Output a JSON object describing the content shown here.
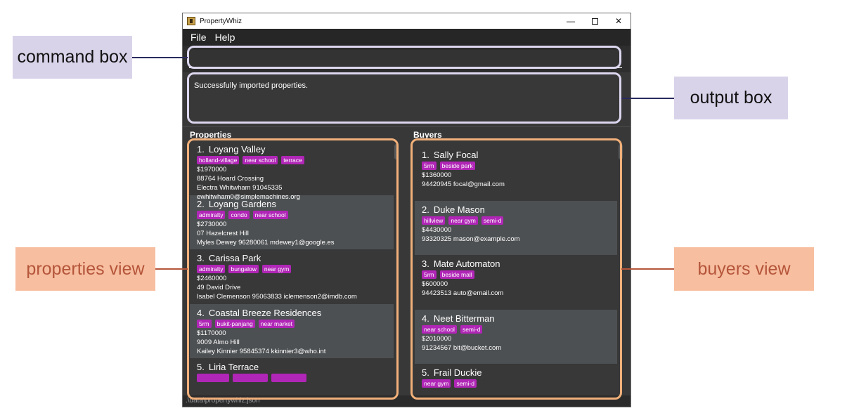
{
  "window": {
    "title": "PropertyWhiz",
    "controls": {
      "minimize": "—",
      "close": "✕"
    }
  },
  "menu": {
    "file": "File",
    "help": "Help"
  },
  "command": {
    "value": ""
  },
  "output": {
    "text": "Successfully imported properties."
  },
  "properties": {
    "title": "Properties",
    "items": [
      {
        "index": "1.",
        "name": "Loyang Valley",
        "tags": [
          "holland-village",
          "near school",
          "terrace"
        ],
        "price": "$1970000",
        "address": "88764 Hoard Crossing",
        "seller": "Electra Whitwham  91045335",
        "email": "ewhitwham0@simplemachines.org"
      },
      {
        "index": "2.",
        "name": "Loyang Gardens",
        "tags": [
          "admiralty",
          "condo",
          "near school"
        ],
        "price": "$2730000",
        "address": "07 Hazelcrest Hill",
        "seller": "Myles Dewey  96280061  mdewey1@google.es",
        "email": ""
      },
      {
        "index": "3.",
        "name": "Carissa Park",
        "tags": [
          "admiralty",
          "bungalow",
          "near gym"
        ],
        "price": "$2460000",
        "address": "49 David Drive",
        "seller": "Isabel Clemenson  95063833  iclemenson2@imdb.com",
        "email": ""
      },
      {
        "index": "4.",
        "name": "Coastal Breeze Residences",
        "tags": [
          "5rm",
          "bukit-panjang",
          "near market"
        ],
        "price": "$1170000",
        "address": "9009 Almo Hill",
        "seller": "Kailey Kinnier  95845374  kkinnier3@who.int",
        "email": ""
      },
      {
        "index": "5.",
        "name": "Liria Terrace",
        "tags": [
          "",
          "",
          ""
        ],
        "price": "",
        "address": "",
        "seller": "",
        "email": ""
      }
    ]
  },
  "buyers": {
    "title": "Buyers",
    "items": [
      {
        "index": "1.",
        "name": "Sally Focal",
        "tags": [
          "5rm",
          "beside park"
        ],
        "budget": "$1360000",
        "contact": "94420945  focal@gmail.com"
      },
      {
        "index": "2.",
        "name": "Duke Mason",
        "tags": [
          "hillview",
          "near gym",
          "semi-d"
        ],
        "budget": "$4430000",
        "contact": "93320325  mason@example.com"
      },
      {
        "index": "3.",
        "name": "Mate Automaton",
        "tags": [
          "5rm",
          "beside mall"
        ],
        "budget": "$600000",
        "contact": "94423513  auto@email.com"
      },
      {
        "index": "4.",
        "name": "Neet Bitterman",
        "tags": [
          "near school",
          "semi-d"
        ],
        "budget": "$2010000",
        "contact": "91234567  bit@bucket.com"
      },
      {
        "index": "5.",
        "name": "Frail Duckie",
        "tags": [
          "near gym",
          "semi-d"
        ],
        "budget": "",
        "contact": ""
      }
    ]
  },
  "status": {
    "path": ".\\data\\propertywhiz.json"
  },
  "annotations": {
    "command_box": "command box",
    "output_box": "output box",
    "properties_view": "properties view",
    "buyers_view": "buyers view"
  },
  "colors": {
    "tag": "#b026b6",
    "window_bg": "#383838",
    "card_alt": "#4d5052",
    "highlight_lavender": "#dcd6ee",
    "highlight_orange": "#f1b07a",
    "callout_lavender": "#d9d3ea",
    "callout_orange": "#f7bea0",
    "callout_orange_text": "#b5553a"
  }
}
